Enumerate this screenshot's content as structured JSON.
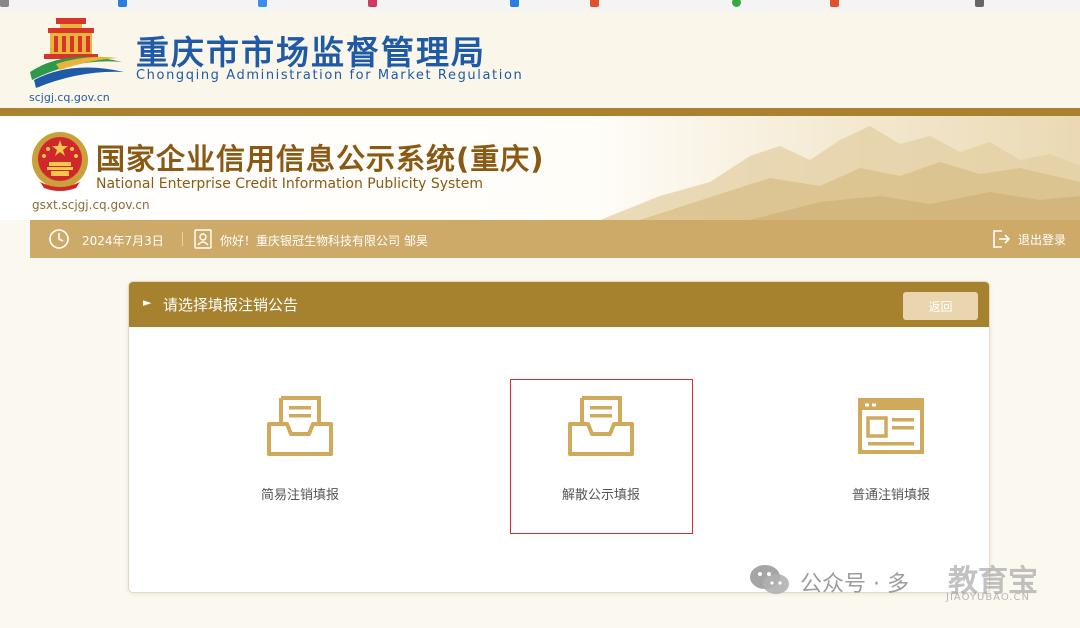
{
  "header": {
    "cn_title": "重庆市市场监督管理局",
    "en_title": "Chongqing  Administration for Market Regulation",
    "domain": "scjgj.cq.gov.cn"
  },
  "system_banner": {
    "cn_title": "国家企业信用信息公示系统(重庆)",
    "en_title": "National Enterprise Credit Information Publicity System",
    "domain": "gsxt.scjgj.cq.gov.cn"
  },
  "info_bar": {
    "date": "2024年7月3日",
    "greeting": "你好！重庆银冠生物科技有限公司   邹昊",
    "logout_label": "退出登录"
  },
  "card": {
    "title": "请选择填报注销公告",
    "back_label": "返回",
    "options": [
      {
        "label": "简易注销填报",
        "icon": "inbox-document-icon"
      },
      {
        "label": "解散公示填报",
        "icon": "inbox-document-icon",
        "selected": true
      },
      {
        "label": "普通注销填报",
        "icon": "form-window-icon"
      }
    ]
  },
  "watermark": {
    "text": "公众号 · 多",
    "brand": "教育宝",
    "sub": "JIAOYUBAO.CN"
  },
  "colors": {
    "gold_dark": "#a6822f",
    "gold_light": "#ceaa68",
    "blue_title": "#1f5aa6",
    "brown_title": "#8a5a14",
    "selection_red": "#d52b35",
    "icon_gold": "#d1a95a"
  }
}
